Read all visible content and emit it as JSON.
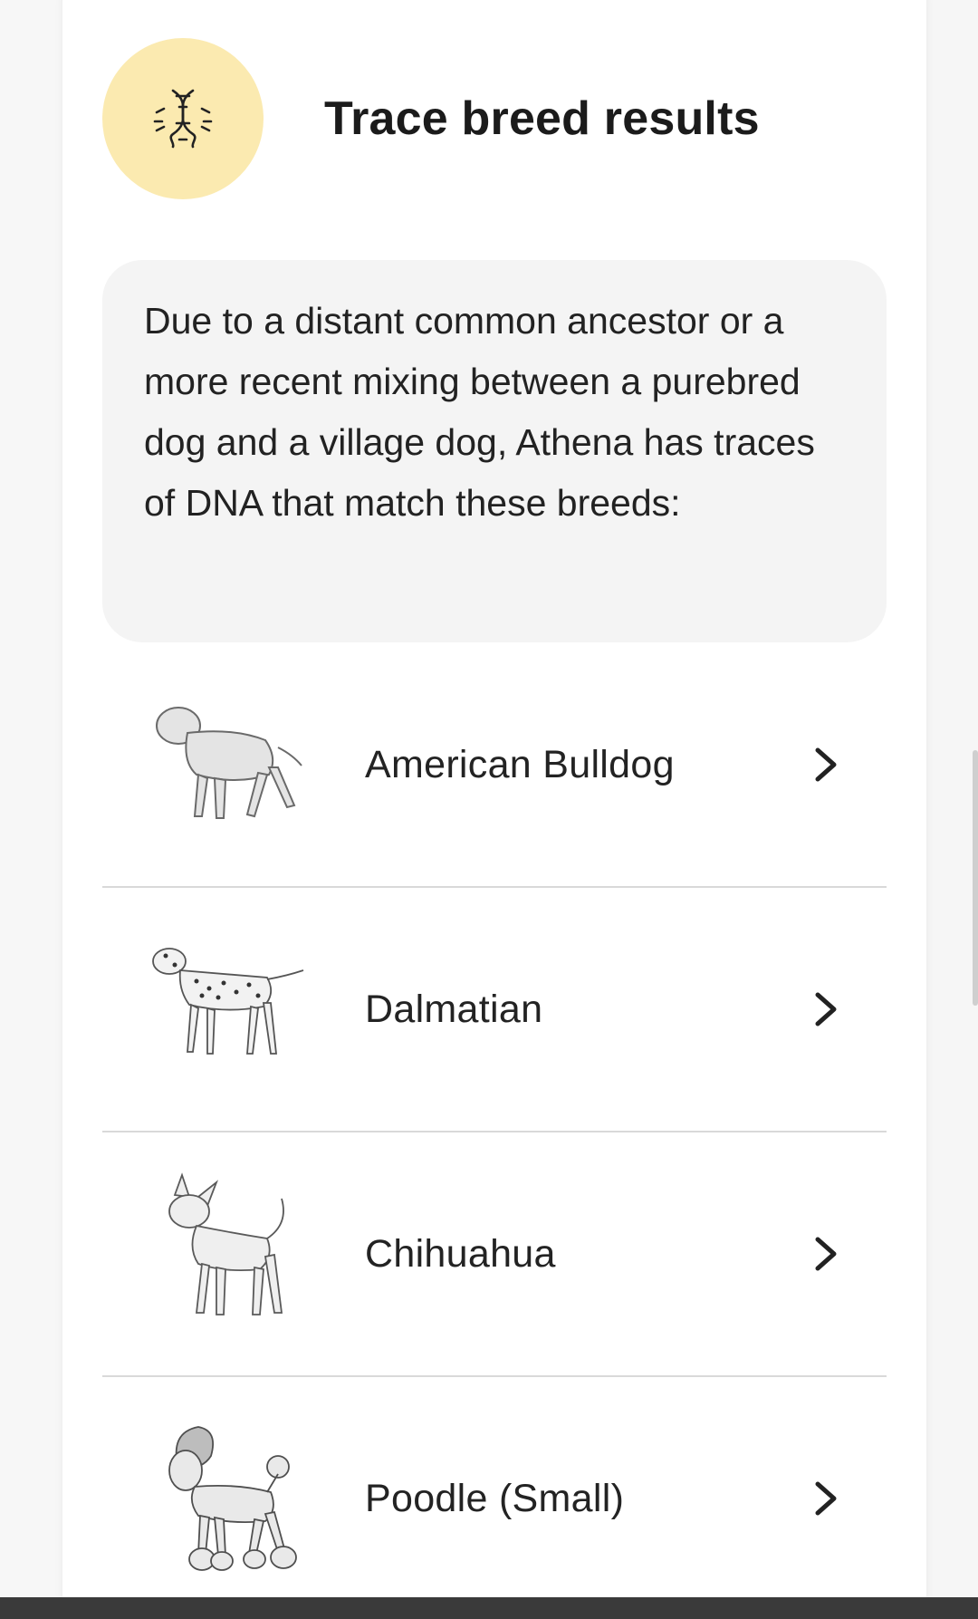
{
  "header": {
    "title": "Trace breed results",
    "icon": "dna-icon",
    "icon_bg": "#fbeab0"
  },
  "info": {
    "text": "Due to a distant common ancestor or a more recent mixing between a purebred dog and a village dog, Athena has traces of DNA that match these breeds:"
  },
  "breeds": [
    {
      "name": "American Bulldog",
      "icon": "american-bulldog-illustration"
    },
    {
      "name": "Dalmatian",
      "icon": "dalmatian-illustration"
    },
    {
      "name": "Chihuahua",
      "icon": "chihuahua-illustration"
    },
    {
      "name": "Poodle (Small)",
      "icon": "poodle-illustration"
    }
  ]
}
